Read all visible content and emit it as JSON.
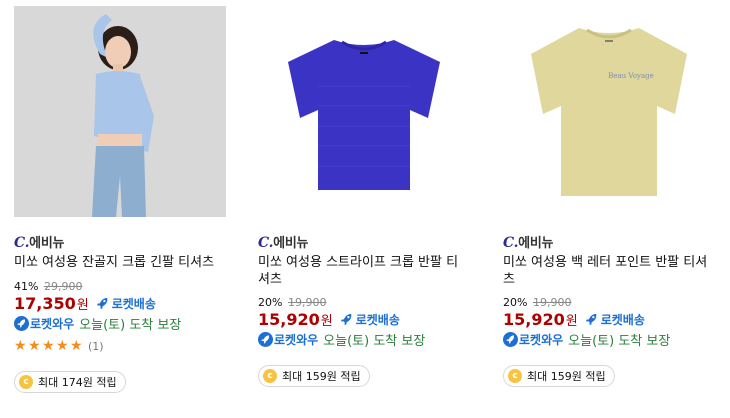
{
  "products": [
    {
      "brand_prefix": "C.",
      "brand_name": "에비뉴",
      "title": "미쏘 여성용 잔골지 크롭 긴팔 티셔츠",
      "discount": "41%",
      "original_price": "29,900",
      "price": "17,350",
      "price_unit": "원",
      "rocket_label": "로켓배송",
      "wow_label": "로켓와우",
      "arrival": "오늘(토) 도착 보장",
      "rating": 5,
      "review_count": "(1)",
      "reward": "최대 174원 적립",
      "coin_symbol": "c",
      "image_color": "#a9c6ea"
    },
    {
      "brand_prefix": "C.",
      "brand_name": "에비뉴",
      "title": "미쏘 여성용 스트라이프 크롭 반팔 티셔츠",
      "discount": "20%",
      "original_price": "19,900",
      "price": "15,920",
      "price_unit": "원",
      "rocket_label": "로켓배송",
      "wow_label": "로켓와우",
      "arrival": "오늘(토) 도착 보장",
      "reward": "최대 159원 적립",
      "coin_symbol": "c",
      "image_color": "#3b33c4"
    },
    {
      "brand_prefix": "C.",
      "brand_name": "에비뉴",
      "title": "미쏘 여성용 백 레터 포인트 반팔 티셔츠",
      "discount": "20%",
      "original_price": "19,900",
      "price": "15,920",
      "price_unit": "원",
      "rocket_label": "로켓배송",
      "wow_label": "로켓와우",
      "arrival": "오늘(토) 도착 보장",
      "reward": "최대 159원 적립",
      "coin_symbol": "c",
      "image_color": "#dfd79c",
      "shirt_print": "Beau Voyage"
    }
  ],
  "colors": {
    "price": "#ae0000",
    "rocket": "#1d6fd6",
    "arrival": "#2a7f3b",
    "star": "#f68b1e"
  }
}
